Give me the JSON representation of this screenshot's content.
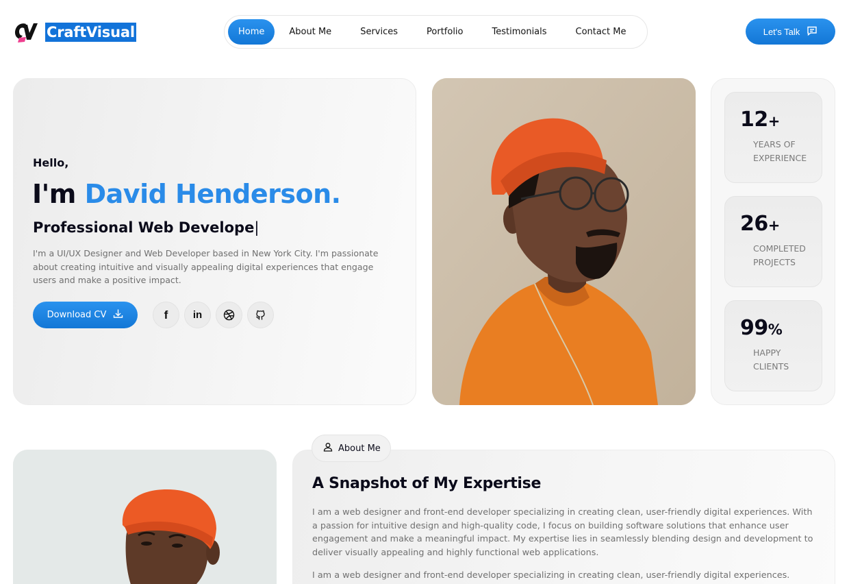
{
  "brand": {
    "name": "CraftVisual"
  },
  "nav": {
    "items": [
      {
        "label": "Home",
        "active": true
      },
      {
        "label": "About Me"
      },
      {
        "label": "Services"
      },
      {
        "label": "Portfolio"
      },
      {
        "label": "Testimonials"
      },
      {
        "label": "Contact Me"
      }
    ],
    "cta_label": "Let's Talk",
    "cta_icon": "chat-icon"
  },
  "hero": {
    "greeting": "Hello,",
    "im_prefix": "I'm ",
    "name": "David Henderson.",
    "role": "Professional  Web Develope",
    "role_caret": "|",
    "bio": "I'm a UI/UX Designer and Web Developer based in New York City. I'm passionate about creating intuitive and visually appealing digital experiences that engage users and make a positive impact.",
    "cv_label": "Download CV",
    "cv_icon": "download-icon",
    "socials": [
      {
        "icon": "facebook-icon",
        "glyph": "f"
      },
      {
        "icon": "linkedin-icon",
        "glyph": "in"
      },
      {
        "icon": "dribbble-icon"
      },
      {
        "icon": "github-icon"
      }
    ]
  },
  "stats": [
    {
      "value": "12",
      "suffix": "+",
      "label": "YEARS OF EXPERIENCE"
    },
    {
      "value": "26",
      "suffix": "+",
      "label": "COMPLETED PROJECTS"
    },
    {
      "value": "99",
      "suffix": "%",
      "label": "HAPPY CLIENTS"
    }
  ],
  "about": {
    "tab_label": "About Me",
    "tab_icon": "user-icon",
    "title": "A Snapshot of My Expertise",
    "paragraph1": "I am a web designer and front-end developer specializing in creating clean, user-friendly digital experiences. With a passion for intuitive design and high-quality code, I focus on building software solutions that enhance user engagement and make a meaningful impact. My expertise lies in seamlessly blending design and development to deliver visually appealing and highly functional web applications.",
    "paragraph2": "I am a web designer and front-end developer specializing in creating clean, user-friendly digital experiences."
  },
  "colors": {
    "accent": "#1F86E3",
    "text": "#0B0B1A",
    "muted": "#6F6F6F",
    "card_bg": "#EFEFEF"
  }
}
